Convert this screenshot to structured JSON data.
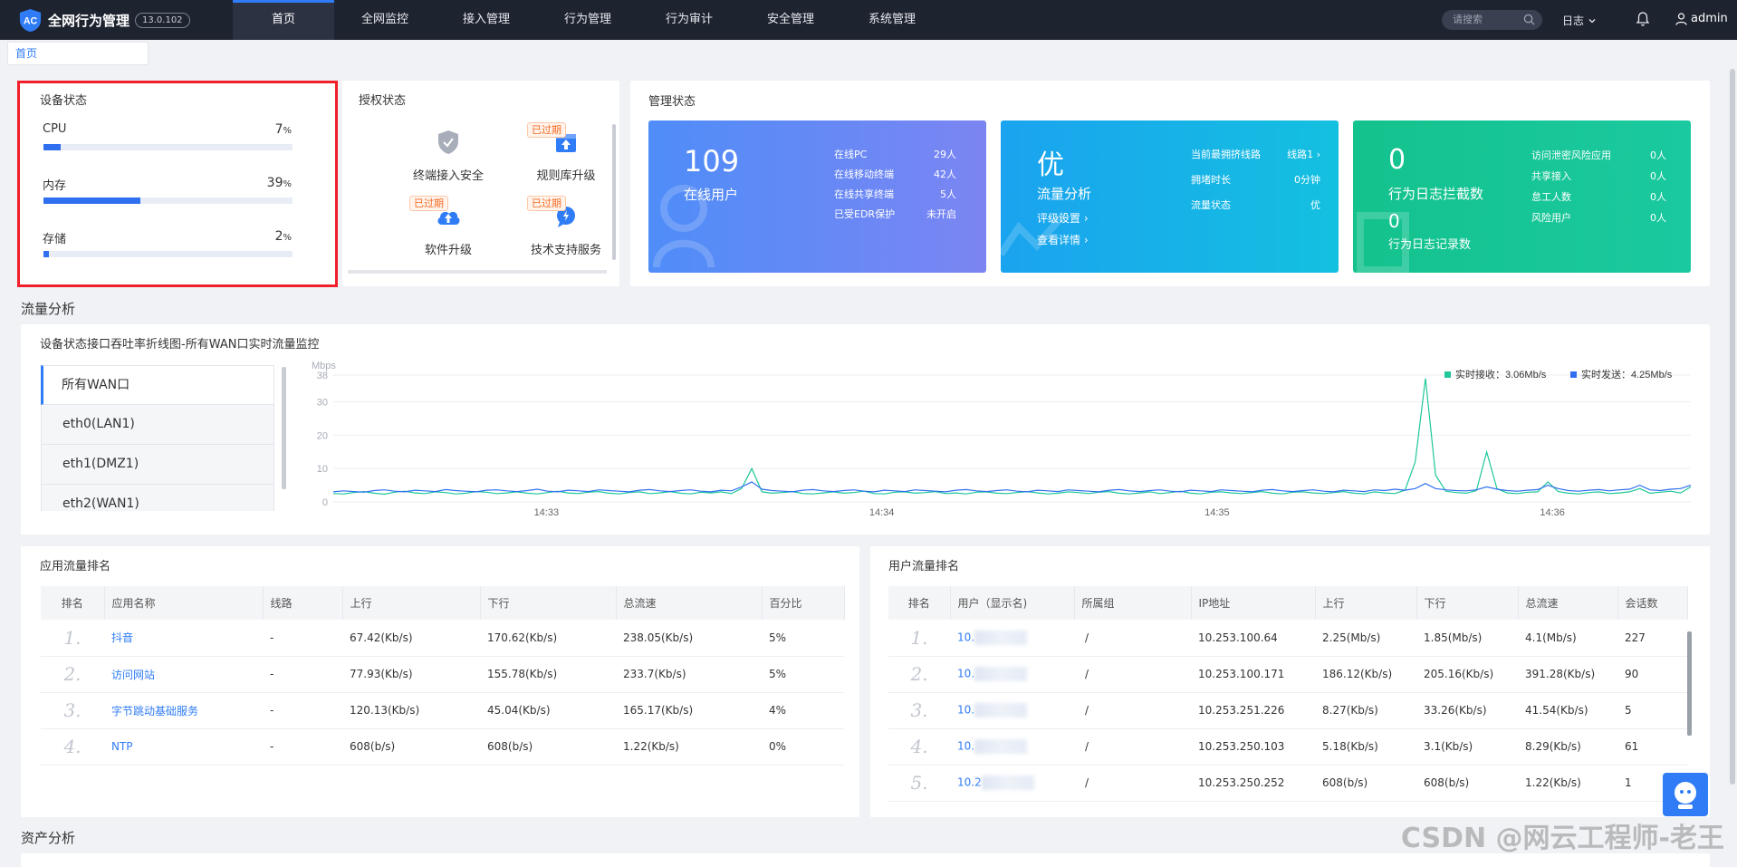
{
  "header": {
    "logo_text": "AC",
    "title": "全网行为管理",
    "version": "13.0.102",
    "nav": [
      {
        "label": "首页"
      },
      {
        "label": "全网监控"
      },
      {
        "label": "接入管理"
      },
      {
        "label": "行为管理"
      },
      {
        "label": "行为审计"
      },
      {
        "label": "安全管理"
      },
      {
        "label": "系统管理"
      }
    ],
    "search_placeholder": "请搜索",
    "log_menu": "日志",
    "user": "admin"
  },
  "tabs": {
    "home": "首页"
  },
  "device_status": {
    "title": "设备状态",
    "items": [
      {
        "label": "CPU",
        "value": "7",
        "unit": "%",
        "percent": 7
      },
      {
        "label": "内存",
        "value": "39",
        "unit": "%",
        "percent": 39
      },
      {
        "label": "存储",
        "value": "2",
        "unit": "%",
        "percent": 2
      }
    ]
  },
  "license_status": {
    "title": "授权状态",
    "expired_label": "已过期",
    "items": [
      {
        "label": "终端接入安全",
        "expired": false
      },
      {
        "label": "规则库升级",
        "expired": true
      },
      {
        "label": "软件升级",
        "expired": true
      },
      {
        "label": "技术支持服务",
        "expired": true
      }
    ]
  },
  "management_status": {
    "title": "管理状态",
    "online": {
      "count": "109",
      "label": "在线用户",
      "rows": [
        {
          "k": "在线PC",
          "v": "29人"
        },
        {
          "k": "在线移动终端",
          "v": "42人"
        },
        {
          "k": "在线共享终端",
          "v": "5人"
        },
        {
          "k": "已受EDR保护",
          "v": "未开启"
        }
      ],
      "color_from": "#4f8df8",
      "color_to": "#7b85f2"
    },
    "traffic": {
      "grade": "优",
      "label": "流量分析",
      "link1": "评级设置 ›",
      "link2": "查看详情 ›",
      "rows": [
        {
          "k": "当前最拥挤线路",
          "v": "线路1 ›"
        },
        {
          "k": "拥堵时长",
          "v": "0分钟"
        },
        {
          "k": "流量状态",
          "v": "优"
        }
      ],
      "color_from": "#1aa3ef",
      "color_to": "#14c0e0"
    },
    "behavior": {
      "count1": "0",
      "label1": "行为日志拦截数",
      "count2": "0",
      "label2": "行为日志记录数",
      "rows": [
        {
          "k": "访问泄密风险应用",
          "v": "0人"
        },
        {
          "k": "共享接入",
          "v": "0人"
        },
        {
          "k": "怠工人数",
          "v": "0人"
        },
        {
          "k": "风险用户",
          "v": "0人"
        }
      ],
      "color_from": "#13c28d",
      "color_to": "#1bc9a0"
    }
  },
  "flow_section": {
    "title": "流量分析",
    "chart_title": "设备状态接口吞吐率折线图-所有WAN口实时流量监控",
    "ports": [
      {
        "label": "所有WAN口"
      },
      {
        "label": "eth0(LAN1)"
      },
      {
        "label": "eth1(DMZ1)"
      },
      {
        "label": "eth2(WAN1)"
      }
    ]
  },
  "chart_data": {
    "type": "line",
    "ylabel": "Mbps",
    "y_ticks": [
      0,
      10,
      20,
      30,
      38
    ],
    "ylim": [
      0,
      38
    ],
    "x_ticks": [
      "14:33",
      "14:34",
      "14:35",
      "14:36"
    ],
    "legend": [
      {
        "name": "实时接收：3.06Mb/s",
        "color": "#1fc79a"
      },
      {
        "name": "实时发送：4.25Mb/s",
        "color": "#2f6ff0"
      }
    ],
    "series": [
      {
        "name": "实时接收",
        "color": "#1fc79a",
        "values": [
          2.5,
          2.4,
          2.8,
          3.1,
          2.6,
          2.3,
          2.9,
          3.2,
          2.7,
          2.5,
          3.0,
          2.8,
          2.4,
          2.6,
          3.1,
          2.9,
          2.5,
          2.7,
          3.0,
          2.6,
          2.4,
          2.8,
          3.2,
          2.7,
          2.5,
          2.9,
          3.1,
          2.6,
          2.4,
          2.8,
          3.0,
          2.5,
          2.7,
          3.1,
          2.6,
          2.4,
          2.9,
          2.7,
          3.0,
          2.5,
          4.0,
          10.0,
          3.0,
          2.6,
          2.8,
          3.1,
          2.5,
          2.4,
          2.7,
          3.0,
          2.6,
          2.8,
          3.2,
          2.5,
          2.4,
          2.9,
          3.0,
          2.6,
          2.8,
          3.1,
          2.5,
          2.7,
          2.4,
          2.9,
          3.0,
          2.6,
          2.5,
          2.8,
          3.1,
          2.7,
          2.4,
          2.6,
          3.0,
          2.8,
          2.5,
          2.9,
          3.1,
          2.6,
          2.4,
          2.7,
          3.0,
          2.5,
          2.8,
          3.2,
          2.6,
          2.4,
          2.9,
          3.0,
          2.7,
          2.5,
          2.8,
          3.1,
          2.6,
          2.4,
          2.9,
          3.0,
          2.7,
          2.5,
          2.8,
          3.1,
          2.6,
          2.4,
          3.0,
          2.7,
          2.5,
          3.5,
          12.0,
          37.0,
          8.0,
          3.2,
          2.8,
          2.6,
          3.4,
          15.0,
          4.0,
          2.7,
          2.5,
          2.9,
          3.0,
          6.0,
          3.1,
          2.6,
          2.4,
          2.8,
          3.0,
          2.5,
          2.7,
          3.0,
          4.0,
          2.6,
          2.9,
          3.2,
          2.7,
          4.5
        ]
      },
      {
        "name": "实时发送",
        "color": "#2f6ff0",
        "values": [
          3.0,
          3.3,
          3.1,
          2.9,
          3.4,
          3.6,
          3.2,
          3.0,
          3.5,
          3.3,
          3.1,
          3.7,
          3.4,
          3.2,
          3.0,
          3.5,
          3.6,
          3.3,
          3.1,
          3.4,
          3.8,
          3.2,
          3.0,
          3.5,
          3.3,
          3.1,
          3.6,
          3.4,
          3.2,
          3.0,
          3.5,
          3.7,
          3.3,
          3.1,
          3.4,
          3.6,
          3.2,
          3.0,
          3.5,
          3.3,
          4.5,
          6.0,
          3.8,
          3.4,
          3.2,
          3.0,
          3.5,
          3.7,
          3.3,
          3.1,
          3.4,
          3.6,
          3.2,
          3.0,
          3.5,
          3.3,
          3.1,
          3.6,
          3.4,
          3.2,
          3.0,
          3.5,
          3.7,
          3.3,
          3.1,
          3.4,
          3.6,
          3.2,
          3.0,
          3.5,
          3.3,
          3.1,
          3.6,
          3.4,
          3.2,
          3.0,
          3.5,
          3.7,
          3.3,
          3.1,
          3.4,
          3.6,
          3.2,
          3.0,
          3.5,
          3.3,
          3.1,
          3.6,
          3.4,
          3.2,
          3.0,
          3.5,
          3.7,
          3.3,
          3.1,
          3.4,
          3.6,
          3.2,
          3.0,
          3.5,
          3.3,
          3.1,
          3.6,
          3.4,
          3.8,
          3.5,
          4.0,
          5.5,
          4.0,
          3.6,
          3.4,
          3.3,
          3.6,
          4.5,
          3.8,
          3.4,
          3.2,
          3.5,
          3.7,
          5.0,
          4.0,
          3.4,
          3.2,
          3.5,
          3.7,
          3.3,
          3.6,
          3.8,
          5.0,
          3.6,
          3.4,
          3.8,
          4.0,
          5.0
        ]
      }
    ]
  },
  "app_rank": {
    "title": "应用流量排名",
    "columns": [
      "排名",
      "应用名称",
      "线路",
      "上行",
      "下行",
      "总流速",
      "百分比"
    ],
    "rows": [
      {
        "rank": "1.",
        "name": "抖音",
        "line": "-",
        "up": "67.42(Kb/s)",
        "down": "170.62(Kb/s)",
        "total": "238.05(Kb/s)",
        "pct": "5%"
      },
      {
        "rank": "2.",
        "name": "访问网站",
        "line": "-",
        "up": "77.93(Kb/s)",
        "down": "155.78(Kb/s)",
        "total": "233.7(Kb/s)",
        "pct": "5%"
      },
      {
        "rank": "3.",
        "name": "字节跳动基础服务",
        "line": "-",
        "up": "120.13(Kb/s)",
        "down": "45.04(Kb/s)",
        "total": "165.17(Kb/s)",
        "pct": "4%"
      },
      {
        "rank": "4.",
        "name": "NTP",
        "line": "-",
        "up": "608(b/s)",
        "down": "608(b/s)",
        "total": "1.22(Kb/s)",
        "pct": "0%"
      }
    ]
  },
  "user_rank": {
    "title": "用户流量排名",
    "columns": [
      "排名",
      "用户（显示名)",
      "所属组",
      "IP地址",
      "上行",
      "下行",
      "总流速",
      "会话数"
    ],
    "rows": [
      {
        "rank": "1.",
        "user": "10.",
        "group": "/",
        "ip": "10.253.100.64",
        "up": "2.25(Mb/s)",
        "down": "1.85(Mb/s)",
        "total": "4.1(Mb/s)",
        "sessions": "227"
      },
      {
        "rank": "2.",
        "user": "10.",
        "group": "/",
        "ip": "10.253.100.171",
        "up": "186.12(Kb/s)",
        "down": "205.16(Kb/s)",
        "total": "391.28(Kb/s)",
        "sessions": "90"
      },
      {
        "rank": "3.",
        "user": "10.",
        "group": "/",
        "ip": "10.253.251.226",
        "up": "8.27(Kb/s)",
        "down": "33.26(Kb/s)",
        "total": "41.54(Kb/s)",
        "sessions": "5"
      },
      {
        "rank": "4.",
        "user": "10.",
        "group": "/",
        "ip": "10.253.250.103",
        "up": "5.18(Kb/s)",
        "down": "3.1(Kb/s)",
        "total": "8.29(Kb/s)",
        "sessions": "61"
      },
      {
        "rank": "5.",
        "user": "10.2",
        "group": "/",
        "ip": "10.253.250.252",
        "up": "608(b/s)",
        "down": "608(b/s)",
        "total": "1.22(Kb/s)",
        "sessions": "1"
      }
    ]
  },
  "asset_section": {
    "title": "资产分析"
  },
  "watermark": "CSDN @网云工程师-老王"
}
